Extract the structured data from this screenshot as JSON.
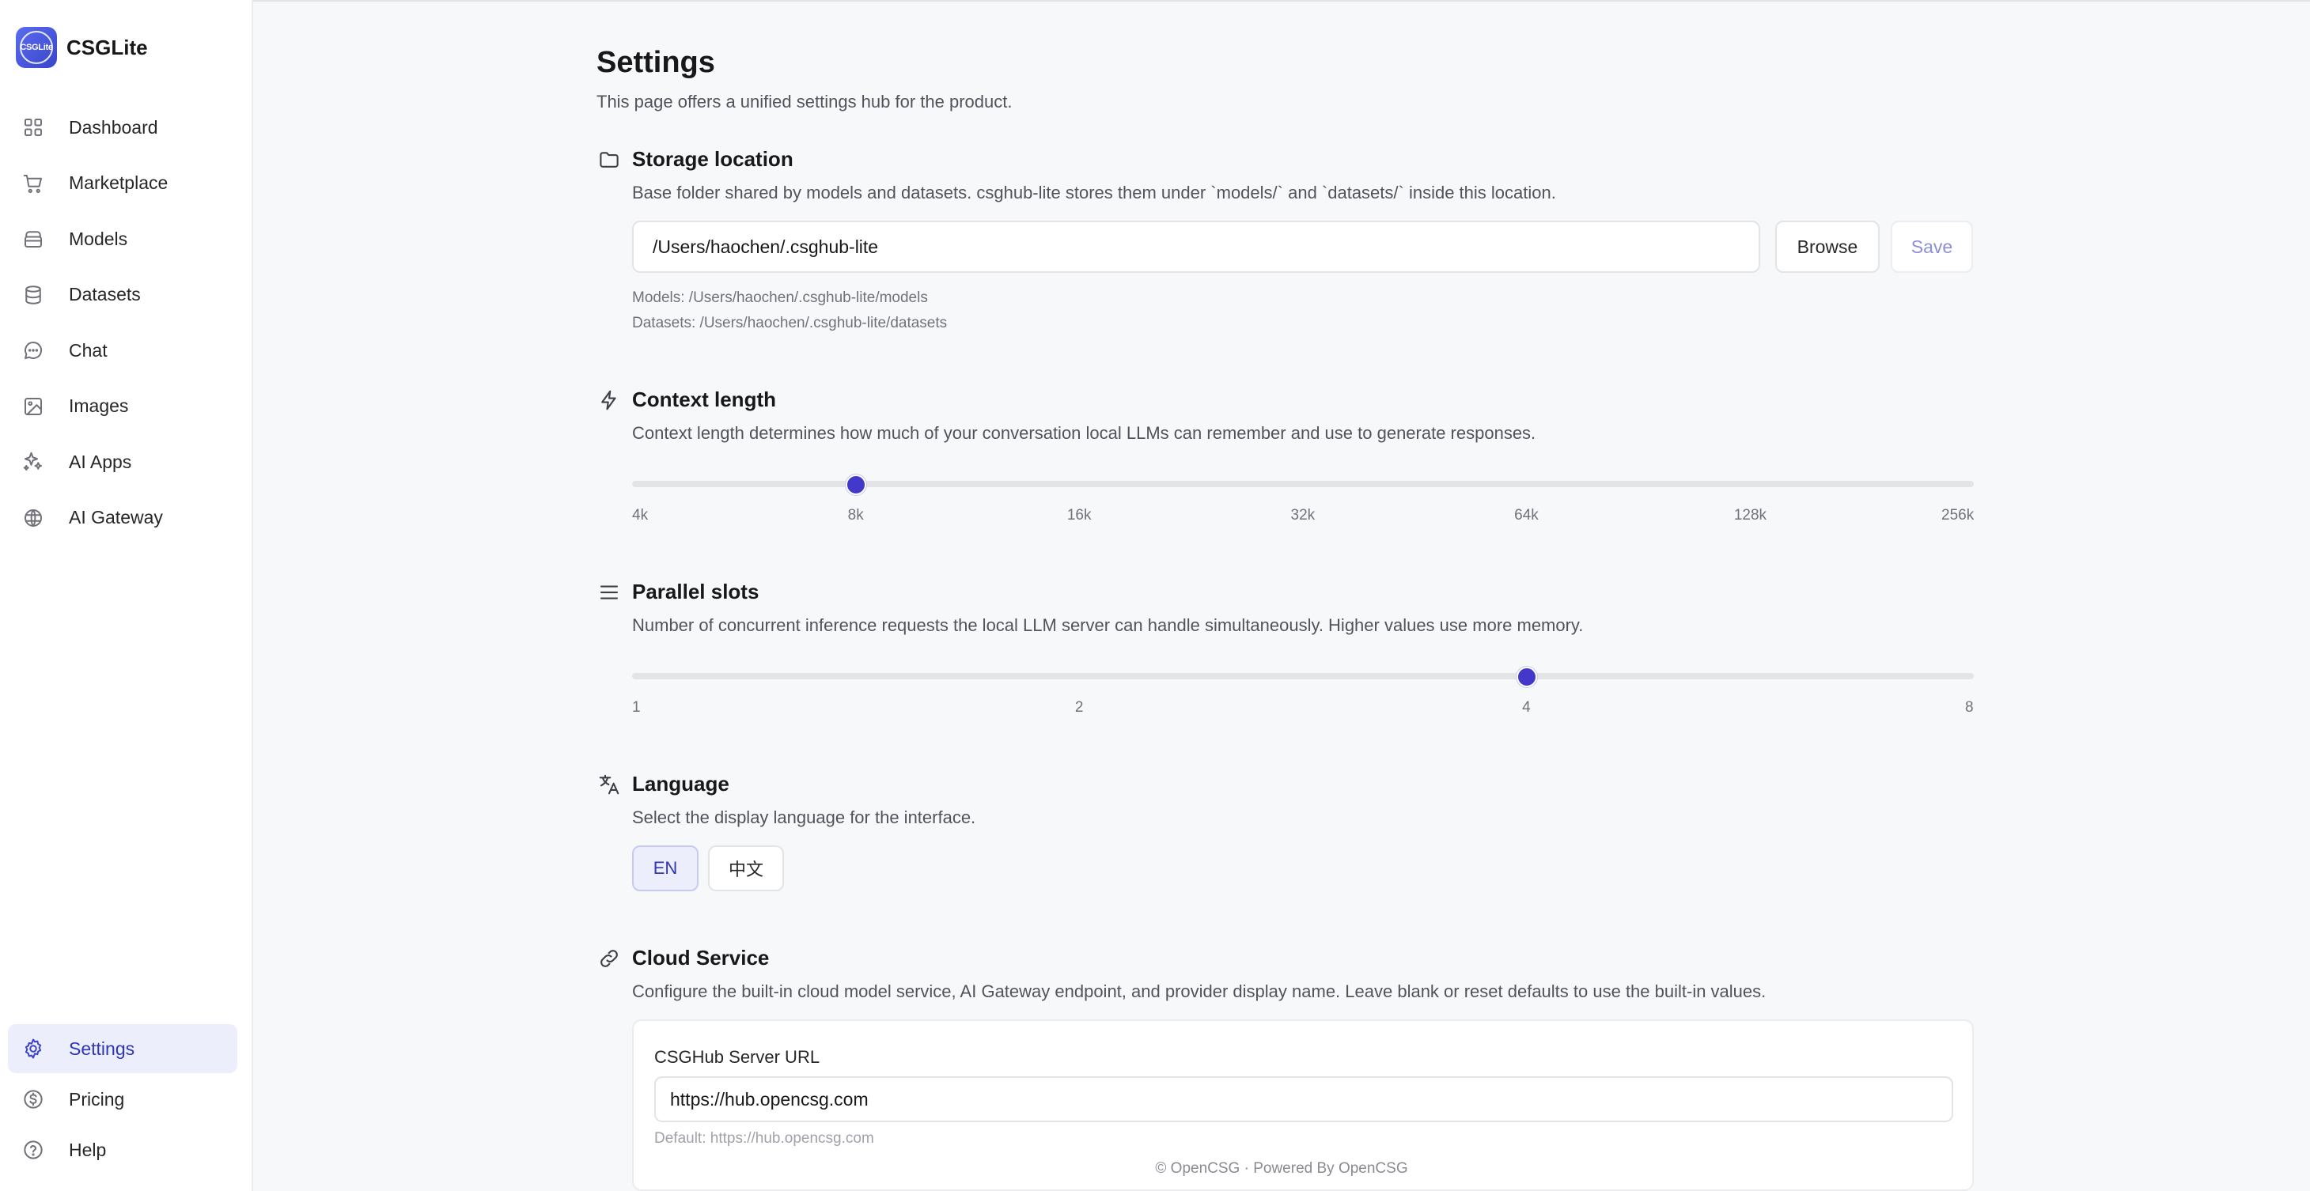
{
  "app": {
    "name": "CSGLite",
    "logo_text": "CSGLite"
  },
  "sidebar": {
    "items": [
      {
        "label": "Dashboard",
        "icon": "dashboard-grid-icon"
      },
      {
        "label": "Marketplace",
        "icon": "cart-icon"
      },
      {
        "label": "Models",
        "icon": "model-box-icon"
      },
      {
        "label": "Datasets",
        "icon": "database-icon"
      },
      {
        "label": "Chat",
        "icon": "chat-bubble-icon"
      },
      {
        "label": "Images",
        "icon": "image-icon"
      },
      {
        "label": "AI Apps",
        "icon": "sparkles-icon"
      },
      {
        "label": "AI Gateway",
        "icon": "gateway-icon"
      }
    ],
    "bottom_items": [
      {
        "label": "Settings",
        "icon": "gear-icon",
        "active": true
      },
      {
        "label": "Pricing",
        "icon": "dollar-icon"
      },
      {
        "label": "Help",
        "icon": "help-circle-icon"
      }
    ]
  },
  "page": {
    "title": "Settings",
    "subtitle": "This page offers a unified settings hub for the product."
  },
  "storage": {
    "title": "Storage location",
    "description": "Base folder shared by models and datasets. csghub-lite stores them under `models/` and `datasets/` inside this location.",
    "path_value": "/Users/haochen/.csghub-lite",
    "browse_label": "Browse",
    "save_label": "Save",
    "models_path": "Models: /Users/haochen/.csghub-lite/models",
    "datasets_path": "Datasets: /Users/haochen/.csghub-lite/datasets"
  },
  "context": {
    "title": "Context length",
    "description": "Context length determines how much of your conversation local LLMs can remember and use to generate responses.",
    "ticks": [
      "4k",
      "8k",
      "16k",
      "32k",
      "64k",
      "128k",
      "256k"
    ],
    "selected": "8k",
    "selected_index": 1
  },
  "parallel": {
    "title": "Parallel slots",
    "description": "Number of concurrent inference requests the local LLM server can handle simultaneously. Higher values use more memory.",
    "ticks": [
      "1",
      "2",
      "4",
      "8"
    ],
    "selected": "4",
    "selected_index": 2
  },
  "language": {
    "title": "Language",
    "description": "Select the display language for the interface.",
    "options": [
      "EN",
      "中文"
    ],
    "selected": "EN"
  },
  "cloud": {
    "title": "Cloud Service",
    "description": "Configure the built-in cloud model service, AI Gateway endpoint, and provider display name. Leave blank or reset defaults to use the built-in values.",
    "server_url_label": "CSGHub Server URL",
    "server_url_value": "https://hub.opencsg.com",
    "server_url_default": "Default: https://hub.opencsg.com"
  },
  "footer": {
    "text": "© OpenCSG · Powered By OpenCSG"
  },
  "colors": {
    "accent": "#4338ca",
    "active_bg": "#eceefc"
  }
}
